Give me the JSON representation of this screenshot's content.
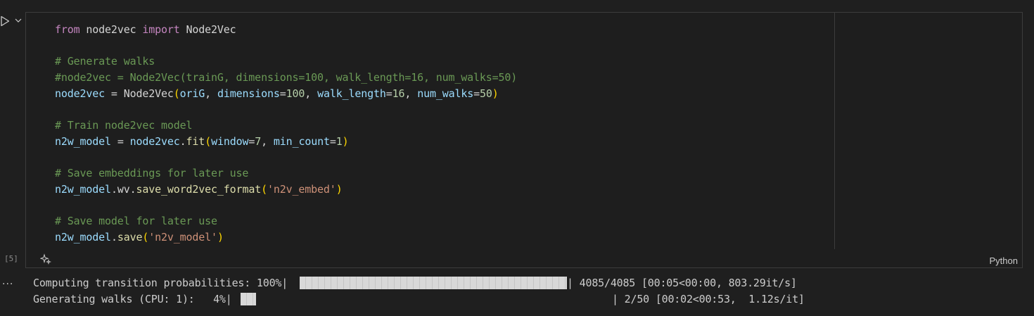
{
  "cell": {
    "execution_count": "[5]",
    "language": "Python",
    "code_lines": [
      [
        {
          "t": "from",
          "c": "kw"
        },
        {
          "t": " node2vec ",
          "c": "op"
        },
        {
          "t": "import",
          "c": "kw"
        },
        {
          "t": " Node2Vec",
          "c": "cls"
        }
      ],
      [],
      [
        {
          "t": "# Generate walks",
          "c": "cmt"
        }
      ],
      [
        {
          "t": "#node2vec = Node2Vec(trainG, dimensions=100, walk_length=16, num_walks=50)",
          "c": "cmt"
        }
      ],
      [
        {
          "t": "node2vec",
          "c": "var"
        },
        {
          "t": " = ",
          "c": "op"
        },
        {
          "t": "Node2Vec",
          "c": "cls"
        },
        {
          "t": "(",
          "c": "par1"
        },
        {
          "t": "oriG",
          "c": "var"
        },
        {
          "t": ", ",
          "c": "op"
        },
        {
          "t": "dimensions",
          "c": "var"
        },
        {
          "t": "=",
          "c": "op"
        },
        {
          "t": "100",
          "c": "num"
        },
        {
          "t": ", ",
          "c": "op"
        },
        {
          "t": "walk_length",
          "c": "var"
        },
        {
          "t": "=",
          "c": "op"
        },
        {
          "t": "16",
          "c": "num"
        },
        {
          "t": ", ",
          "c": "op"
        },
        {
          "t": "num_walks",
          "c": "var"
        },
        {
          "t": "=",
          "c": "op"
        },
        {
          "t": "50",
          "c": "num"
        },
        {
          "t": ")",
          "c": "par1"
        }
      ],
      [],
      [
        {
          "t": "# Train node2vec model",
          "c": "cmt"
        }
      ],
      [
        {
          "t": "n2w_model",
          "c": "var"
        },
        {
          "t": " = ",
          "c": "op"
        },
        {
          "t": "node2vec",
          "c": "var"
        },
        {
          "t": ".",
          "c": "op"
        },
        {
          "t": "fit",
          "c": "fn"
        },
        {
          "t": "(",
          "c": "par1"
        },
        {
          "t": "window",
          "c": "var"
        },
        {
          "t": "=",
          "c": "op"
        },
        {
          "t": "7",
          "c": "num"
        },
        {
          "t": ", ",
          "c": "op"
        },
        {
          "t": "min_count",
          "c": "var"
        },
        {
          "t": "=",
          "c": "op"
        },
        {
          "t": "1",
          "c": "num"
        },
        {
          "t": ")",
          "c": "par1"
        }
      ],
      [],
      [
        {
          "t": "# Save embeddings for later use",
          "c": "cmt"
        }
      ],
      [
        {
          "t": "n2w_model",
          "c": "var"
        },
        {
          "t": ".wv.",
          "c": "op"
        },
        {
          "t": "save_word2vec_format",
          "c": "fn"
        },
        {
          "t": "(",
          "c": "par1"
        },
        {
          "t": "'n2v_embed'",
          "c": "str"
        },
        {
          "t": ")",
          "c": "par1"
        }
      ],
      [],
      [
        {
          "t": "# Save model for later use",
          "c": "cmt"
        }
      ],
      [
        {
          "t": "n2w_model",
          "c": "var"
        },
        {
          "t": ".",
          "c": "op"
        },
        {
          "t": "save",
          "c": "fn"
        },
        {
          "t": "(",
          "c": "par1"
        },
        {
          "t": "'n2v_model'",
          "c": "str"
        },
        {
          "t": ")",
          "c": "par1"
        }
      ]
    ]
  },
  "output": {
    "more_label": "...",
    "lines": [
      {
        "prefix": "Computing transition probabilities: 100%|",
        "suffix": "| 4085/4085 [00:05<00:00, 803.29it/s]",
        "progress": 1.0
      },
      {
        "prefix": "Generating walks (CPU: 1):   4%|",
        "suffix": "| 2/50 [00:02<00:53,  1.12s/it]",
        "progress": 0.04
      }
    ]
  }
}
